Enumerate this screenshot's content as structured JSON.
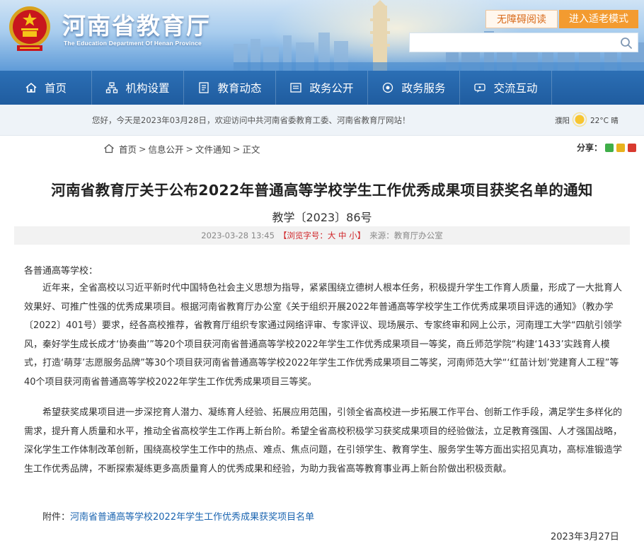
{
  "header": {
    "site_title": "河南省教育厅",
    "site_subtitle": "The Education Department Of Henan Province",
    "accessible_button": "无障碍阅读",
    "elder_mode_button": "进入适老模式",
    "search_placeholder": ""
  },
  "nav": {
    "items": [
      {
        "label": "首页",
        "icon": "home-icon"
      },
      {
        "label": "机构设置",
        "icon": "org-icon"
      },
      {
        "label": "教育动态",
        "icon": "news-icon"
      },
      {
        "label": "政务公开",
        "icon": "open-gov-icon"
      },
      {
        "label": "政务服务",
        "icon": "service-icon"
      },
      {
        "label": "交流互动",
        "icon": "interact-icon"
      }
    ]
  },
  "welcome": {
    "text": "您好，今天是2023年03月28日，欢迎访问中共河南省委教育工委、河南省教育厅网站！",
    "weather_city": "濮阳",
    "weather_temp": "22°C 晴",
    "weather_icon": "sun-icon"
  },
  "breadcrumb": {
    "items": [
      "首页",
      "信息公开",
      "文件通知",
      "正文"
    ],
    "separator": ">"
  },
  "share": {
    "label": "分享：",
    "icons": [
      {
        "name": "wechat-share-icon",
        "color": "#3fae49"
      },
      {
        "name": "qzone-share-icon",
        "color": "#e8b21e"
      },
      {
        "name": "weibo-share-icon",
        "color": "#d83a2f"
      }
    ]
  },
  "article": {
    "title": "河南省教育厅关于公布2022年普通高等学校学生工作优秀成果项目获奖名单的通知",
    "doc_number": "教学〔2023〕86号",
    "meta": {
      "date": "2023-03-28 13:45",
      "font_size_label": "【浏览字号：大 中 小】",
      "source": "来源：教育厅办公室"
    },
    "salutation": "各普通高等学校：",
    "paragraphs": [
      "近年来，全省高校以习近平新时代中国特色社会主义思想为指导，紧紧围绕立德树人根本任务，积极提升学生工作育人质量，形成了一大批育人效果好、可推广性强的优秀成果项目。根据河南省教育厅办公室《关于组织开展2022年普通高等学校学生工作优秀成果项目评选的通知》（教办学〔2022〕401号）要求，经各高校推荐，省教育厅组织专家通过网络评审、专家评议、现场展示、专家终审和网上公示，河南理工大学“四航引领学风，秦好学生成长成才‘协奏曲’”等20个项目获河南省普通高等学校2022年学生工作优秀成果项目一等奖，商丘师范学院“构建‘1433’实践育人模式，打造‘萌芽’志愿服务品牌”等30个项目获河南省普通高等学校2022年学生工作优秀成果项目二等奖，河南师范大学“‘红苗计划’党建育人工程”等40个项目获河南省普通高等学校2022年学生工作优秀成果项目三等奖。",
      "希望获奖成果项目进一步深挖育人潜力、凝练育人经验、拓展应用范围，引领全省高校进一步拓展工作平台、创新工作手段，满足学生多样化的需求，提升育人质量和水平，推动全省高校学生工作再上新台阶。希望全省高校积极学习获奖成果项目的经验做法，立足教育强国、人才强国战略，深化学生工作体制改革创新，围绕高校学生工作中的热点、难点、焦点问题，在引领学生、教育学生、服务学生等方面出实招见真功，高标准锻造学生工作优秀品牌，不断探索凝练更多高质量育人的优秀成果和经验，为助力我省高等教育事业再上新台阶做出积极贡献。"
    ],
    "attachment_label": "附件：",
    "attachment_link": "河南省普通高等学校2022年学生工作优秀成果获奖项目名单",
    "sign_date": "2023年3月27日"
  },
  "colors": {
    "nav_bg": "#1f5c9f",
    "accent_orange": "#f39b30",
    "link_blue": "#1a64b0",
    "meta_red": "#d0262a"
  }
}
